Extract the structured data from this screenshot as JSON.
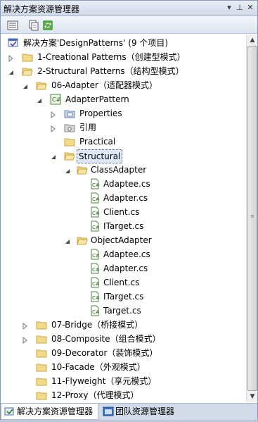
{
  "window": {
    "title": "解决方案资源管理器",
    "buttons": [
      "dropdown",
      "pin",
      "close"
    ]
  },
  "toolbar": {
    "tools": [
      "properties-icon",
      "show-all-files-icon",
      "refresh-icon"
    ]
  },
  "tree": {
    "solution": "解决方案'DesignPatterns' (9 个项目)",
    "n1": "1-Creational Patterns（创建型模式）",
    "n2": "2-Structural Patterns（结构型模式）",
    "n3": "06-Adapter（适配器模式）",
    "n4": "AdapterPattern",
    "n5": "Properties",
    "n6": "引用",
    "n7": "Practical",
    "n8": "Structural",
    "n9": "ClassAdapter",
    "n10": "Adaptee.cs",
    "n11": "Adapter.cs",
    "n12": "Client.cs",
    "n13": "ITarget.cs",
    "n14": "ObjectAdapter",
    "n15": "Adaptee.cs",
    "n16": "Adapter.cs",
    "n17": "Client.cs",
    "n18": "ITarget.cs",
    "n19": "Target.cs",
    "n20": "07-Bridge（桥接模式）",
    "n21": "08-Composite（组合模式）",
    "n22": "09-Decorator（装饰模式）",
    "n23": "10-Facade（外观模式）",
    "n24": "11-Flyweight（享元模式）",
    "n25": "12-Proxy（代理模式）",
    "selected": "Structural"
  },
  "tabs": {
    "solution_explorer": "解决方案资源管理器",
    "team_explorer": "团队资源管理器",
    "active": "solution_explorer"
  },
  "colors": {
    "folder": "#e8c96a",
    "selection": "#dde8f8",
    "title_gradient": "#cfd9e8"
  }
}
